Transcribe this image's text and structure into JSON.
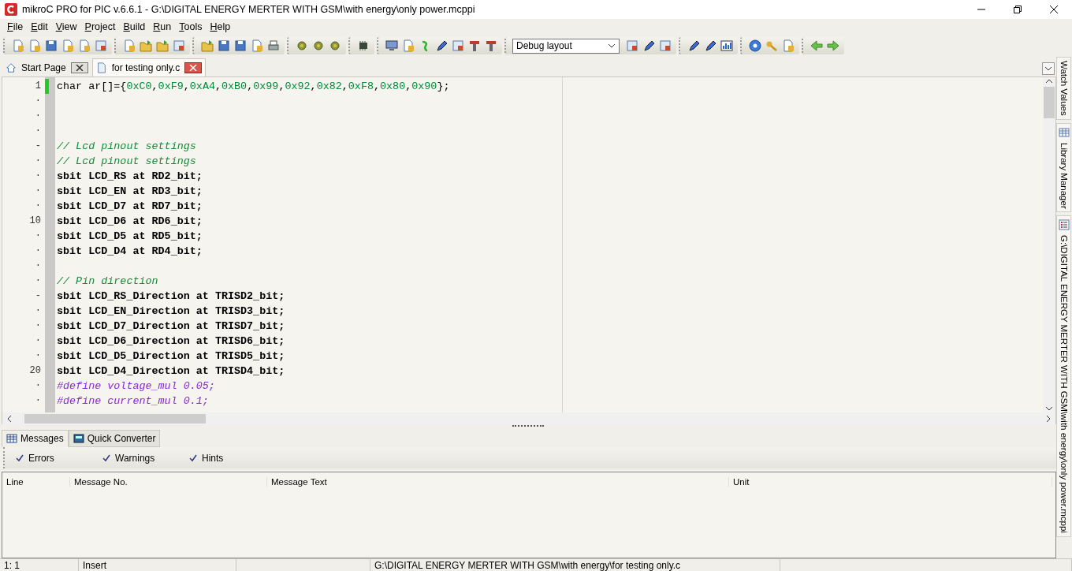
{
  "window": {
    "title": "mikroC PRO for PIC v.6.6.1 - G:\\DIGITAL ENERGY MERTER WITH GSM\\with energy\\only power.mcppi"
  },
  "menu": [
    {
      "label": "File"
    },
    {
      "label": "Edit"
    },
    {
      "label": "View"
    },
    {
      "label": "Project"
    },
    {
      "label": "Build"
    },
    {
      "label": "Run"
    },
    {
      "label": "Tools"
    },
    {
      "label": "Help"
    }
  ],
  "layout_dropdown": {
    "value": "Debug layout"
  },
  "tabs": [
    {
      "label": "Start Page",
      "kind": "home",
      "selected": false
    },
    {
      "label": "for testing only.c",
      "kind": "file",
      "selected": true
    }
  ],
  "editor": {
    "lines": [
      {
        "gutter": "1",
        "modified": true,
        "segments": [
          {
            "text": "char ar[]={",
            "kind": "plain"
          },
          {
            "text": "0xC0",
            "kind": "number"
          },
          {
            "text": ",",
            "kind": "plain"
          },
          {
            "text": "0xF9",
            "kind": "number"
          },
          {
            "text": ",",
            "kind": "plain"
          },
          {
            "text": "0xA4",
            "kind": "number"
          },
          {
            "text": ",",
            "kind": "plain"
          },
          {
            "text": "0xB0",
            "kind": "number"
          },
          {
            "text": ",",
            "kind": "plain"
          },
          {
            "text": "0x99",
            "kind": "number"
          },
          {
            "text": ",",
            "kind": "plain"
          },
          {
            "text": "0x92",
            "kind": "number"
          },
          {
            "text": ",",
            "kind": "plain"
          },
          {
            "text": "0x82",
            "kind": "number"
          },
          {
            "text": ",",
            "kind": "plain"
          },
          {
            "text": "0xF8",
            "kind": "number"
          },
          {
            "text": ",",
            "kind": "plain"
          },
          {
            "text": "0x80",
            "kind": "number"
          },
          {
            "text": ",",
            "kind": "plain"
          },
          {
            "text": "0x90",
            "kind": "number"
          },
          {
            "text": "};",
            "kind": "plain"
          }
        ]
      },
      {
        "gutter": "·",
        "modified": false
      },
      {
        "gutter": "·",
        "modified": false
      },
      {
        "gutter": "·",
        "modified": false
      },
      {
        "gutter": "-",
        "modified": false,
        "segments": [
          {
            "text": "// Lcd pinout settings",
            "kind": "comment"
          }
        ]
      },
      {
        "gutter": "·",
        "modified": false,
        "segments": [
          {
            "text": "// Lcd pinout settings",
            "kind": "comment"
          }
        ]
      },
      {
        "gutter": "·",
        "modified": false,
        "segments": [
          {
            "text": "sbit LCD_RS at RD2_bit;",
            "kind": "keyword"
          }
        ]
      },
      {
        "gutter": "·",
        "modified": false,
        "segments": [
          {
            "text": "sbit LCD_EN at RD3_bit;",
            "kind": "keyword"
          }
        ]
      },
      {
        "gutter": "·",
        "modified": false,
        "segments": [
          {
            "text": "sbit LCD_D7 at RD7_bit;",
            "kind": "keyword"
          }
        ]
      },
      {
        "gutter": "10",
        "modified": false,
        "segments": [
          {
            "text": "sbit LCD_D6 at RD6_bit;",
            "kind": "keyword"
          }
        ]
      },
      {
        "gutter": "·",
        "modified": false,
        "segments": [
          {
            "text": "sbit LCD_D5 at RD5_bit;",
            "kind": "keyword"
          }
        ]
      },
      {
        "gutter": "·",
        "modified": false,
        "segments": [
          {
            "text": "sbit LCD_D4 at RD4_bit;",
            "kind": "keyword"
          }
        ]
      },
      {
        "gutter": "·",
        "modified": false
      },
      {
        "gutter": "·",
        "modified": false,
        "segments": [
          {
            "text": "// Pin direction",
            "kind": "comment"
          }
        ]
      },
      {
        "gutter": "-",
        "modified": false,
        "segments": [
          {
            "text": "sbit LCD_RS_Direction at TRISD2_bit;",
            "kind": "keyword"
          }
        ]
      },
      {
        "gutter": "·",
        "modified": false,
        "segments": [
          {
            "text": "sbit LCD_EN_Direction at TRISD3_bit;",
            "kind": "keyword"
          }
        ]
      },
      {
        "gutter": "·",
        "modified": false,
        "segments": [
          {
            "text": "sbit LCD_D7_Direction at TRISD7_bit;",
            "kind": "keyword"
          }
        ]
      },
      {
        "gutter": "·",
        "modified": false,
        "segments": [
          {
            "text": "sbit LCD_D6_Direction at TRISD6_bit;",
            "kind": "keyword"
          }
        ]
      },
      {
        "gutter": "·",
        "modified": false,
        "segments": [
          {
            "text": "sbit LCD_D5_Direction at TRISD5_bit;",
            "kind": "keyword"
          }
        ]
      },
      {
        "gutter": "20",
        "modified": false,
        "segments": [
          {
            "text": "sbit LCD_D4_Direction at TRISD4_bit;",
            "kind": "keyword"
          }
        ]
      },
      {
        "gutter": "·",
        "modified": false,
        "segments": [
          {
            "text": "#define voltage_mul 0.05;",
            "kind": "directive"
          }
        ]
      },
      {
        "gutter": "·",
        "modified": false,
        "segments": [
          {
            "text": "#define current_mul 0.1;",
            "kind": "directive"
          }
        ]
      }
    ]
  },
  "side_tabs": [
    {
      "label": "Watch Values",
      "kind": "none"
    },
    {
      "label": "Library Manager",
      "kind": "table"
    },
    {
      "label": "G:\\DIGITAL ENERGY MERTER WITH GSM\\with energy\\only power.mcppi",
      "kind": "list"
    }
  ],
  "bottom_tabs": [
    {
      "label": "Messages",
      "kind": "grid",
      "selected": true
    },
    {
      "label": "Quick Converter",
      "kind": "calc",
      "selected": false
    }
  ],
  "filters": [
    {
      "label": "Errors",
      "checked": true
    },
    {
      "label": "Warnings",
      "checked": true
    },
    {
      "label": "Hints",
      "checked": true
    }
  ],
  "messages_table": {
    "columns": [
      "Line",
      "Message No.",
      "Message Text",
      "Unit"
    ]
  },
  "status_bar": [
    {
      "text": "1: 1"
    },
    {
      "text": "Insert"
    },
    {
      "text": "G:\\DIGITAL ENERGY MERTER WITH GSM\\with energy\\for testing only.c"
    }
  ]
}
